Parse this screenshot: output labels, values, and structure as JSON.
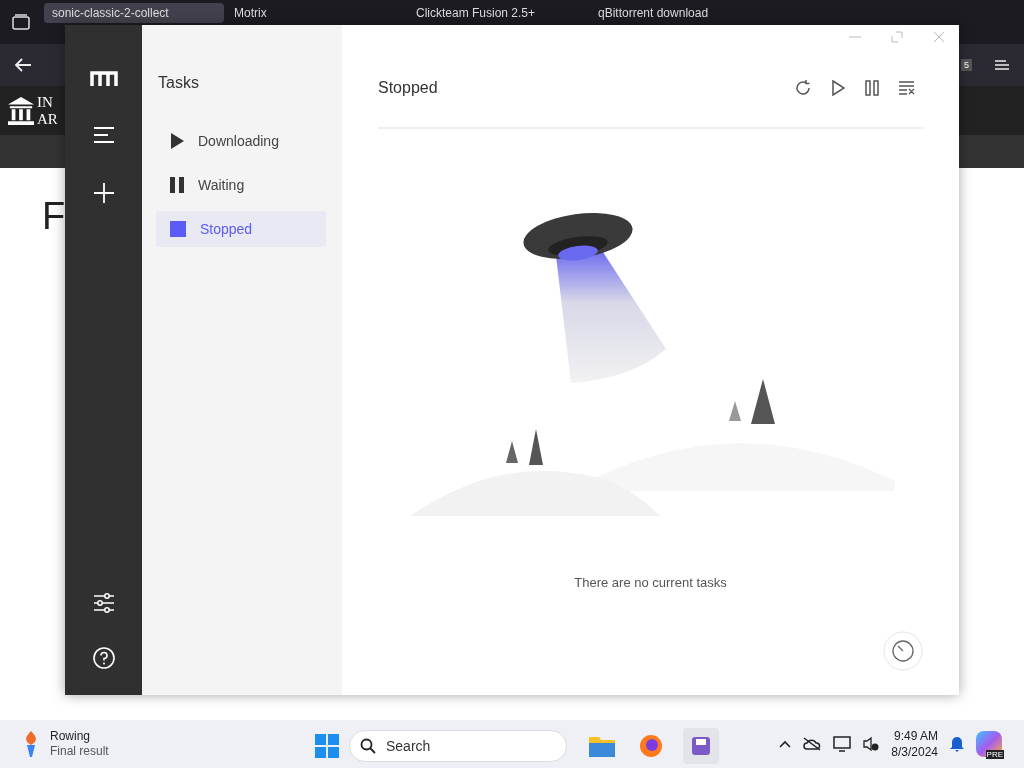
{
  "browser": {
    "tabs": [
      {
        "label": "sonic-classic-2-collect",
        "selected": true
      },
      {
        "label": "Motrix",
        "selected": false
      },
      {
        "label": "Clickteam Fusion 2.5+",
        "selected": false
      },
      {
        "label": "qBittorrent download",
        "selected": false
      }
    ],
    "badge": "5",
    "logo_lines": [
      "IN",
      "AR"
    ],
    "heading": "F"
  },
  "app": {
    "tasks_title": "Tasks",
    "filters": [
      {
        "label": "Downloading",
        "kind": "play",
        "selected": false
      },
      {
        "label": "Waiting",
        "kind": "pause",
        "selected": false
      },
      {
        "label": "Stopped",
        "kind": "stop",
        "selected": true
      }
    ],
    "main_title": "Stopped",
    "empty_message": "There are no current tasks"
  },
  "taskbar": {
    "weather_title": "Rowing",
    "weather_subtitle": "Final result",
    "search_placeholder": "Search",
    "time": "9:49 AM",
    "date": "8/3/2024",
    "copilot_badge": "PRE"
  }
}
